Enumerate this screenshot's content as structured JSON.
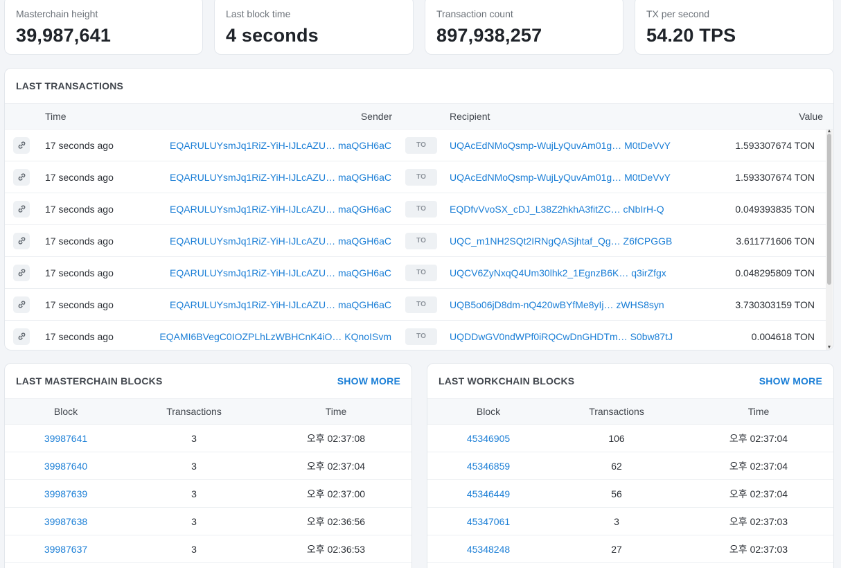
{
  "stats": [
    {
      "label": "Masterchain height",
      "value": "39,987,641"
    },
    {
      "label": "Last block time",
      "value": "4 seconds"
    },
    {
      "label": "Transaction count",
      "value": "897,938,257"
    },
    {
      "label": "TX per second",
      "value": "54.20 TPS"
    }
  ],
  "transactions": {
    "title": "LAST TRANSACTIONS",
    "columns": {
      "time": "Time",
      "sender": "Sender",
      "recipient": "Recipient",
      "value": "Value"
    },
    "to_label": "TO",
    "rows": [
      {
        "time": "17 seconds ago",
        "sender": "EQARULUYsmJq1RiZ-YiH-IJLcAZU… maQGH6aC",
        "recipient": "UQAcEdNMoQsmp-WujLyQuvAm01g… M0tDeVvY",
        "value": "1.593307674 TON"
      },
      {
        "time": "17 seconds ago",
        "sender": "EQARULUYsmJq1RiZ-YiH-IJLcAZU… maQGH6aC",
        "recipient": "UQAcEdNMoQsmp-WujLyQuvAm01g… M0tDeVvY",
        "value": "1.593307674 TON"
      },
      {
        "time": "17 seconds ago",
        "sender": "EQARULUYsmJq1RiZ-YiH-IJLcAZU… maQGH6aC",
        "recipient": "EQDfvVvoSX_cDJ_L38Z2hkhA3fitZC… cNbIrH-Q",
        "value": "0.049393835 TON"
      },
      {
        "time": "17 seconds ago",
        "sender": "EQARULUYsmJq1RiZ-YiH-IJLcAZU… maQGH6aC",
        "recipient": "UQC_m1NH2SQt2IRNgQASjhtaf_Qg… Z6fCPGGB",
        "value": "3.611771606 TON"
      },
      {
        "time": "17 seconds ago",
        "sender": "EQARULUYsmJq1RiZ-YiH-IJLcAZU… maQGH6aC",
        "recipient": "UQCV6ZyNxqQ4Um30lhk2_1EgnzB6K… q3irZfgx",
        "value": "0.048295809 TON"
      },
      {
        "time": "17 seconds ago",
        "sender": "EQARULUYsmJq1RiZ-YiH-IJLcAZU… maQGH6aC",
        "recipient": "UQB5o06jD8dm-nQ420wBYfMe8yIj… zWHS8syn",
        "value": "3.730303159 TON"
      },
      {
        "time": "17 seconds ago",
        "sender": "EQAMI6BVegC0IOZPLhLzWBHCnK4iO… KQnoISvm",
        "recipient": "UQDDwGV0ndWPf0iRQCwDnGHDTm… S0bw87tJ",
        "value": "0.004618 TON"
      }
    ]
  },
  "masterchain": {
    "title": "LAST MASTERCHAIN BLOCKS",
    "show_more": "SHOW MORE",
    "columns": {
      "block": "Block",
      "transactions": "Transactions",
      "time": "Time"
    },
    "rows": [
      {
        "block": "39987641",
        "transactions": "3",
        "time": "오후 02:37:08"
      },
      {
        "block": "39987640",
        "transactions": "3",
        "time": "오후 02:37:04"
      },
      {
        "block": "39987639",
        "transactions": "3",
        "time": "오후 02:37:00"
      },
      {
        "block": "39987638",
        "transactions": "3",
        "time": "오후 02:36:56"
      },
      {
        "block": "39987637",
        "transactions": "3",
        "time": "오후 02:36:53"
      }
    ]
  },
  "workchain": {
    "title": "LAST WORKCHAIN BLOCKS",
    "show_more": "SHOW MORE",
    "columns": {
      "block": "Block",
      "transactions": "Transactions",
      "time": "Time"
    },
    "rows": [
      {
        "block": "45346905",
        "transactions": "106",
        "time": "오후 02:37:04"
      },
      {
        "block": "45346859",
        "transactions": "62",
        "time": "오후 02:37:04"
      },
      {
        "block": "45346449",
        "transactions": "56",
        "time": "오후 02:37:04"
      },
      {
        "block": "45347061",
        "transactions": "3",
        "time": "오후 02:37:03"
      },
      {
        "block": "45348248",
        "transactions": "27",
        "time": "오후 02:37:03"
      }
    ]
  },
  "icons": {
    "row_link": "link-icon",
    "scroll_up": "scroll-up-arrow-icon",
    "scroll_down": "scroll-down-arrow-icon"
  }
}
